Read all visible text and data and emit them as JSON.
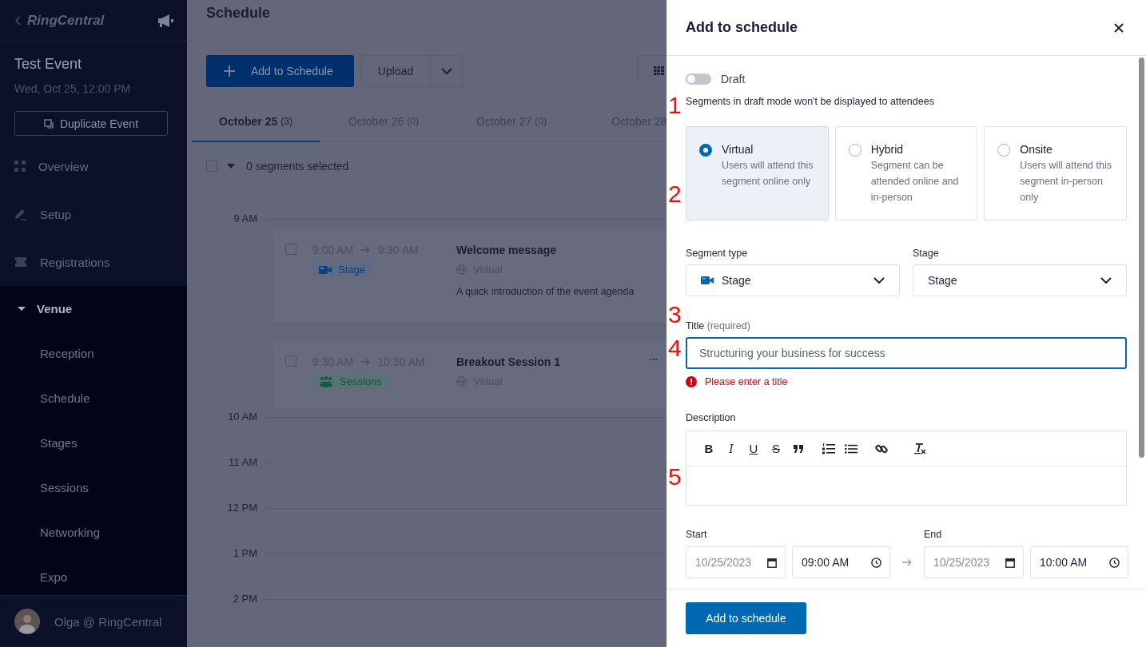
{
  "sidebar": {
    "brand": "RingCentral",
    "event_title": "Test Event",
    "event_date": "Wed, Oct 25, 12:00 PM",
    "duplicate_button": "Duplicate Event",
    "items": [
      {
        "label": "Overview"
      },
      {
        "label": "Setup"
      },
      {
        "label": "Registrations"
      },
      {
        "label": "Venue",
        "expanded": true,
        "children": [
          {
            "label": "Reception"
          },
          {
            "label": "Schedule"
          },
          {
            "label": "Stages"
          },
          {
            "label": "Sessions"
          },
          {
            "label": "Networking"
          },
          {
            "label": "Expo"
          }
        ]
      }
    ],
    "user": "Olga @ RingCentral"
  },
  "main": {
    "title": "Schedule",
    "add_button": "Add to Schedule",
    "upload_button": "Upload",
    "tabs": [
      {
        "label": "October 25",
        "count": "(3)",
        "selected": true
      },
      {
        "label": "October 26",
        "count": "(0)",
        "selected": false
      },
      {
        "label": "October 27",
        "count": "(0)",
        "selected": false
      },
      {
        "label": "October 28",
        "selected": false
      }
    ],
    "select_all_checked": false,
    "selection_text": "0 segments selected",
    "hours": [
      {
        "label": "9 AM",
        "segments": [
          {
            "checked": false,
            "start": "9:00 AM",
            "end": "9:30 AM",
            "kind": "stage",
            "tag": "Stage",
            "title": "Welcome message",
            "mode": "Virtual",
            "description": "A quick introduction of the event agenda"
          },
          {
            "checked": false,
            "start": "9:30 AM",
            "end": "10:30 AM",
            "kind": "sessions",
            "tag": "Sessions",
            "title": "Breakout Session 1",
            "mode": "Virtual",
            "menu": "•••"
          }
        ]
      },
      {
        "label": "10 AM"
      },
      {
        "label": "11 AM"
      },
      {
        "label": "12 PM"
      },
      {
        "label": "1 PM"
      },
      {
        "label": "2 PM"
      }
    ]
  },
  "panel": {
    "title": "Add to schedule",
    "draft": {
      "label": "Draft",
      "on": false,
      "note": "Segments in draft mode won't be displayed to attendees"
    },
    "modes": [
      {
        "label": "Virtual",
        "description": "Users will attend this segment online only",
        "selected": true
      },
      {
        "label": "Hybrid",
        "description": "Segment can be attended online and in-person",
        "selected": false
      },
      {
        "label": "Onsite",
        "description": "Users will attend this segment in-person only",
        "selected": false
      }
    ],
    "segment_type": {
      "label": "Segment type",
      "value": "Stage"
    },
    "stage": {
      "label": "Stage",
      "value": "Stage"
    },
    "title_field": {
      "label": "Title",
      "hint": "(required)",
      "placeholder": "Structuring your business for success",
      "error": "Please enter a title"
    },
    "description": {
      "label": "Description",
      "toolbar": [
        {
          "kind": "bold",
          "label": "B"
        },
        {
          "kind": "italic",
          "label": "I"
        },
        {
          "kind": "underline",
          "label": "U"
        },
        {
          "kind": "strike",
          "label": "S"
        },
        {
          "kind": "quote"
        },
        {
          "kind": "ordered-list"
        },
        {
          "kind": "bullet-list"
        },
        {
          "kind": "link"
        },
        {
          "kind": "clear-format"
        }
      ]
    },
    "start": {
      "label": "Start",
      "date": "10/25/2023",
      "time": "09:00 AM"
    },
    "end": {
      "label": "End",
      "date": "10/25/2023",
      "time": "10:00 AM"
    },
    "submit": "Add to schedule"
  },
  "annotations": [
    "1",
    "2",
    "3",
    "4",
    "5"
  ]
}
